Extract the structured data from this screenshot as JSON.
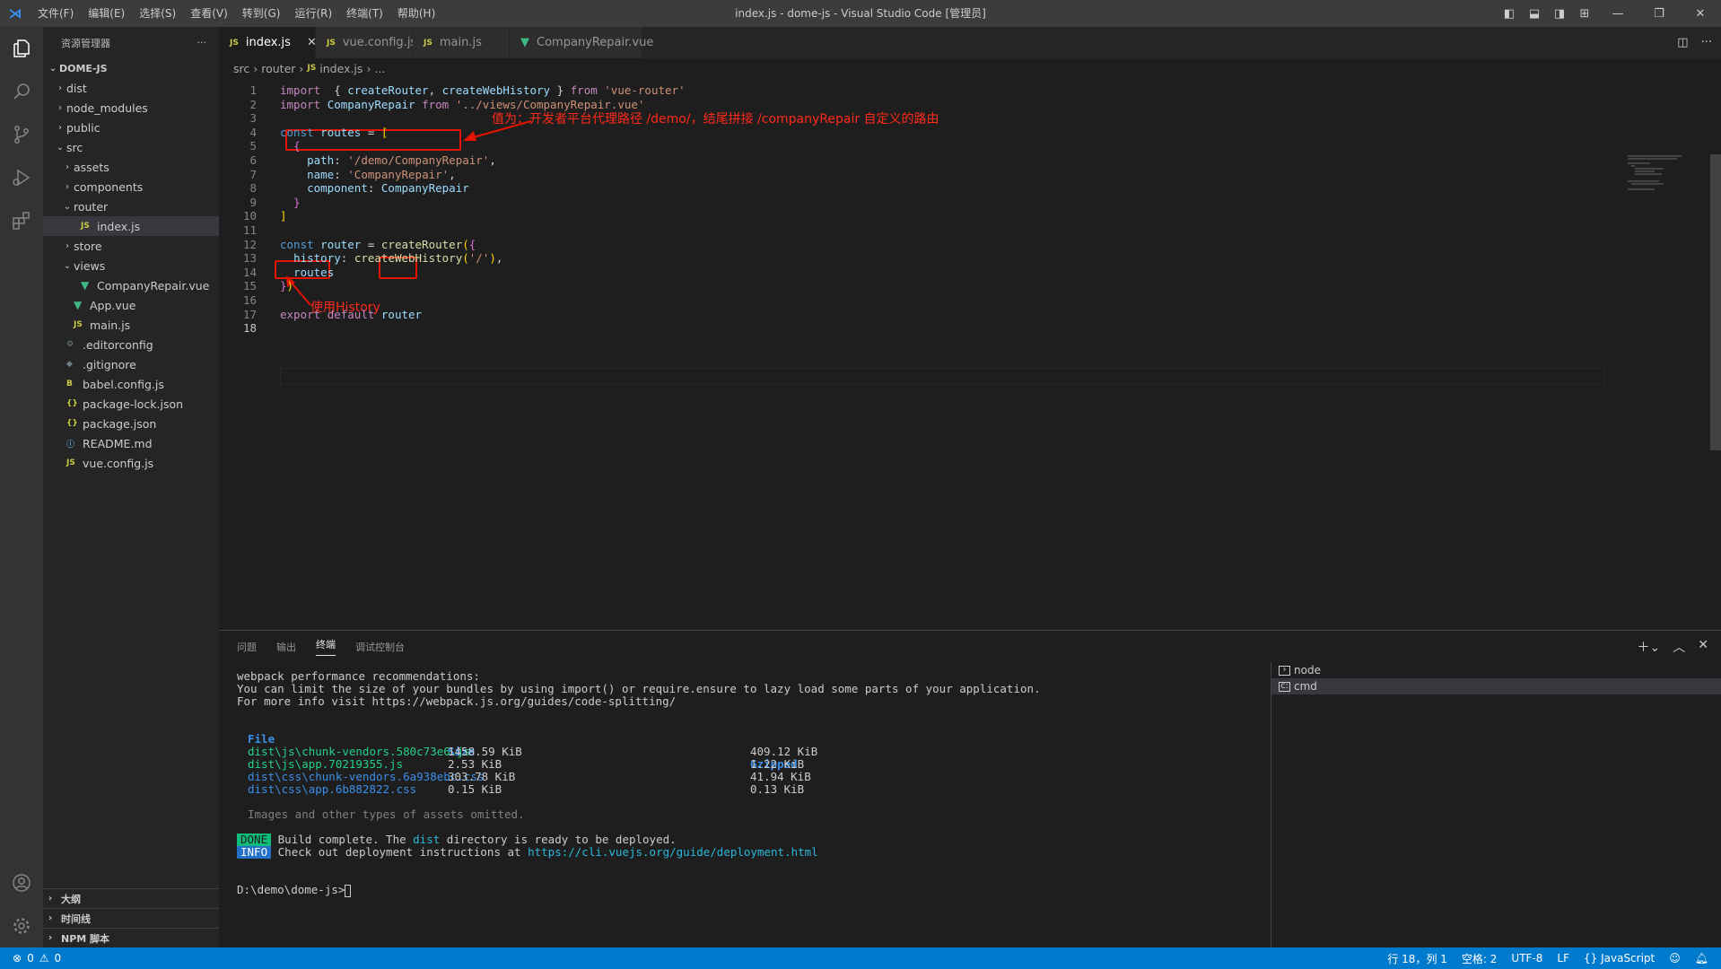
{
  "window": {
    "title": "index.js - dome-js - Visual Studio Code [管理员]",
    "menu": [
      "文件(F)",
      "编辑(E)",
      "选择(S)",
      "查看(V)",
      "转到(G)",
      "运行(R)",
      "终端(T)",
      "帮助(H)"
    ]
  },
  "sidebar": {
    "title": "资源管理器",
    "more": "···",
    "root": "DOME-JS",
    "tree": [
      {
        "label": "dist",
        "twisty": "›",
        "icon": "",
        "kind": "",
        "indent": 1
      },
      {
        "label": "node_modules",
        "twisty": "›",
        "icon": "",
        "kind": "",
        "indent": 1
      },
      {
        "label": "public",
        "twisty": "›",
        "icon": "",
        "kind": "",
        "indent": 1
      },
      {
        "label": "src",
        "twisty": "⌄",
        "icon": "",
        "kind": "",
        "indent": 1
      },
      {
        "label": "assets",
        "twisty": "›",
        "icon": "",
        "kind": "",
        "indent": 2
      },
      {
        "label": "components",
        "twisty": "›",
        "icon": "",
        "kind": "",
        "indent": 2
      },
      {
        "label": "router",
        "twisty": "⌄",
        "icon": "",
        "kind": "",
        "indent": 2
      },
      {
        "label": "index.js",
        "twisty": "",
        "icon": "JS",
        "kind": "js",
        "indent": 3,
        "selected": true
      },
      {
        "label": "store",
        "twisty": "›",
        "icon": "",
        "kind": "",
        "indent": 2
      },
      {
        "label": "views",
        "twisty": "⌄",
        "icon": "",
        "kind": "",
        "indent": 2
      },
      {
        "label": "CompanyRepair.vue",
        "twisty": "",
        "icon": "▼",
        "kind": "vue",
        "indent": 3
      },
      {
        "label": "App.vue",
        "twisty": "",
        "icon": "▼",
        "kind": "vue",
        "indent": 2
      },
      {
        "label": "main.js",
        "twisty": "",
        "icon": "JS",
        "kind": "js",
        "indent": 2
      },
      {
        "label": ".editorconfig",
        "twisty": "",
        "icon": "⚙",
        "kind": "cfg",
        "indent": 1
      },
      {
        "label": ".gitignore",
        "twisty": "",
        "icon": "◆",
        "kind": "cfg",
        "indent": 1
      },
      {
        "label": "babel.config.js",
        "twisty": "",
        "icon": "B",
        "kind": "babel",
        "indent": 1
      },
      {
        "label": "package-lock.json",
        "twisty": "",
        "icon": "{}",
        "kind": "json",
        "indent": 1
      },
      {
        "label": "package.json",
        "twisty": "",
        "icon": "{}",
        "kind": "json",
        "indent": 1
      },
      {
        "label": "README.md",
        "twisty": "",
        "icon": "ⓘ",
        "kind": "info",
        "indent": 1
      },
      {
        "label": "vue.config.js",
        "twisty": "",
        "icon": "JS",
        "kind": "js",
        "indent": 1
      }
    ],
    "sections": [
      "大纲",
      "时间线",
      "NPM 脚本"
    ]
  },
  "tabs": [
    {
      "label": "index.js",
      "icon": "JS",
      "active": true
    },
    {
      "label": "vue.config.js",
      "icon": "JS",
      "active": false
    },
    {
      "label": "main.js",
      "icon": "JS",
      "active": false
    },
    {
      "label": "CompanyRepair.vue",
      "icon": "▼",
      "active": false
    }
  ],
  "breadcrumb": {
    "a": "src",
    "b": "router",
    "c": "index.js",
    "d": "..."
  },
  "code_lines": [
    [
      [
        "kw2",
        "import"
      ],
      [
        "",
        "  { "
      ],
      [
        "var",
        "createRouter"
      ],
      [
        "",
        ", "
      ],
      [
        "var",
        "createWebHistory"
      ],
      [
        "",
        " } "
      ],
      [
        "kw2",
        "from"
      ],
      [
        "",
        " "
      ],
      [
        "str",
        "'vue-router'"
      ]
    ],
    [
      [
        "kw2",
        "import"
      ],
      [
        "",
        " "
      ],
      [
        "var",
        "CompanyRepair"
      ],
      [
        "",
        " "
      ],
      [
        "kw2",
        "from"
      ],
      [
        "",
        " "
      ],
      [
        "str",
        "'../views/CompanyRepair.vue'"
      ]
    ],
    [],
    [
      [
        "kw",
        "const"
      ],
      [
        "",
        " "
      ],
      [
        "var",
        "routes"
      ],
      [
        "",
        " = "
      ],
      [
        "br1",
        "["
      ]
    ],
    [
      [
        "",
        "  "
      ],
      [
        "br2",
        "{"
      ]
    ],
    [
      [
        "",
        "    "
      ],
      [
        "var",
        "path"
      ],
      [
        "",
        ": "
      ],
      [
        "str",
        "'/demo/CompanyRepair'"
      ],
      [
        "",
        ","
      ]
    ],
    [
      [
        "",
        "    "
      ],
      [
        "var",
        "name"
      ],
      [
        "",
        ": "
      ],
      [
        "str",
        "'CompanyRepair'"
      ],
      [
        "",
        ","
      ]
    ],
    [
      [
        "",
        "    "
      ],
      [
        "var",
        "component"
      ],
      [
        "",
        ": "
      ],
      [
        "var",
        "CompanyRepair"
      ]
    ],
    [
      [
        "",
        "  "
      ],
      [
        "br2",
        "}"
      ]
    ],
    [
      [
        "br1",
        "]"
      ]
    ],
    [],
    [
      [
        "kw",
        "const"
      ],
      [
        "",
        " "
      ],
      [
        "var",
        "router"
      ],
      [
        "",
        " = "
      ],
      [
        "fn",
        "createRouter"
      ],
      [
        "br1",
        "("
      ],
      [
        "br2",
        "{"
      ]
    ],
    [
      [
        "",
        "  "
      ],
      [
        "var",
        "history"
      ],
      [
        "",
        ": "
      ],
      [
        "fn",
        "createWebHistory"
      ],
      [
        "br1",
        "("
      ],
      [
        "str",
        "'/'"
      ],
      [
        "br1",
        ")"
      ],
      [
        "",
        ","
      ]
    ],
    [
      [
        "",
        "  "
      ],
      [
        "var",
        "routes"
      ]
    ],
    [
      [
        "br2",
        "}"
      ],
      [
        "br1",
        ")"
      ]
    ],
    [],
    [
      [
        "kw2",
        "export"
      ],
      [
        "",
        " "
      ],
      [
        "kw2",
        "default"
      ],
      [
        "",
        " "
      ],
      [
        "var",
        "router"
      ]
    ],
    []
  ],
  "annotations": {
    "path_note": "值为：开发者平台代理路径 /demo/，结尾拼接 /companyRepair 自定义的路由",
    "history_note": "使用History"
  },
  "panel": {
    "tabs": [
      "问题",
      "输出",
      "终端",
      "调试控制台"
    ],
    "active_tab": "终端",
    "terminal": {
      "line1": "webpack performance recommendations:",
      "line2": "You can limit the size of your bundles by using import() or require.ensure to lazy load some parts of your application.",
      "line3": "For more info visit https://webpack.js.org/guides/code-splitting/",
      "headers": {
        "file": "File",
        "size": "Size",
        "gzip": "Gzipped"
      },
      "rows": [
        {
          "file": "dist\\js\\chunk-vendors.580c73e6.js",
          "size": "1458.59 KiB",
          "gzip": "409.12 KiB",
          "kind": "js"
        },
        {
          "file": "dist\\js\\app.70219355.js",
          "size": "2.53 KiB",
          "gzip": "1.22 KiB",
          "kind": "js"
        },
        {
          "file": "dist\\css\\chunk-vendors.6a938ebc.css",
          "size": "303.78 KiB",
          "gzip": "41.94 KiB",
          "kind": "css"
        },
        {
          "file": "dist\\css\\app.6b882822.css",
          "size": "0.15 KiB",
          "gzip": "0.13 KiB",
          "kind": "css"
        }
      ],
      "omitted": "Images and other types of assets omitted.",
      "done_badge": "DONE",
      "done_a": "Build complete. The ",
      "done_dist": "dist",
      "done_b": " directory is ready to be deployed.",
      "info_badge": "INFO",
      "info_a": "Check out deployment instructions at ",
      "info_url": "https://cli.vuejs.org/guide/deployment.html",
      "prompt": "D:\\demo\\dome-js>"
    },
    "terminal_list": [
      "node",
      "cmd"
    ]
  },
  "statusbar": {
    "errors": "0",
    "warnings": "0",
    "position": "行 18，列 1",
    "spaces": "空格: 2",
    "encoding": "UTF-8",
    "eol": "LF",
    "language": "JavaScript"
  }
}
